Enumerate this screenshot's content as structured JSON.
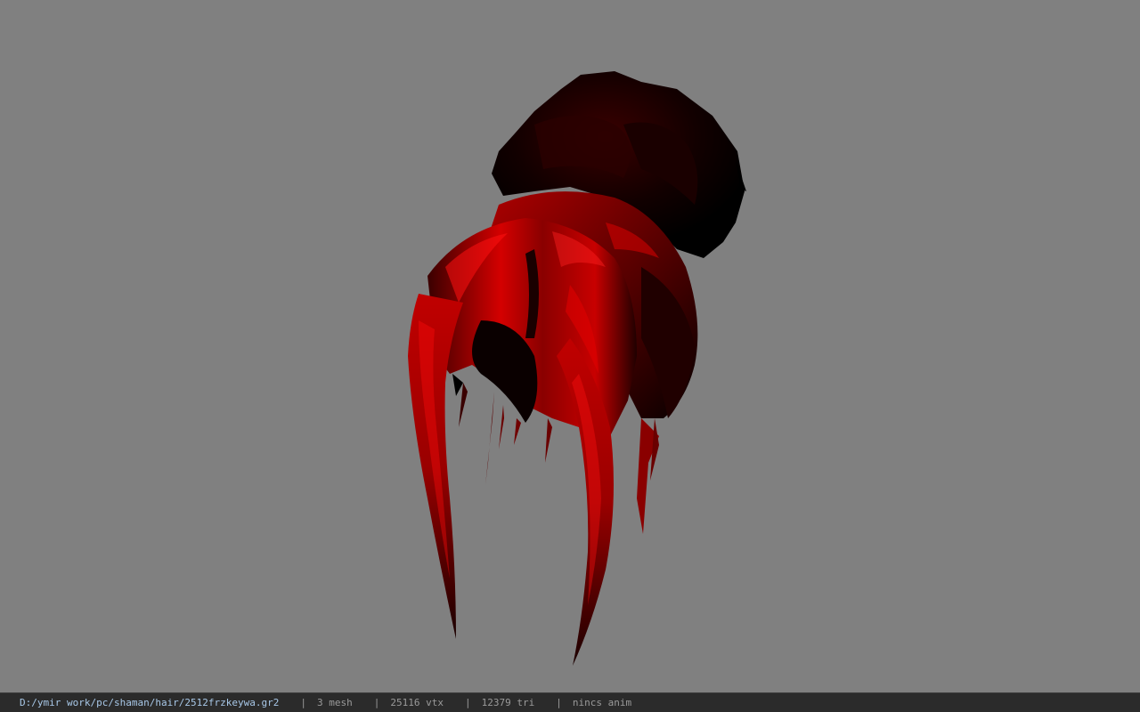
{
  "status_bar": {
    "file_path": "D:/ymir work/pc/shaman/hair/2512frzkeywa.gr2",
    "separator": "|",
    "mesh_count": "3 mesh",
    "vertex_count": "25116 vtx",
    "triangle_count": "12379 tri",
    "animation_status": "nincs anim"
  },
  "viewport": {
    "background_color": "#808080",
    "model": {
      "description_icon": "hair-model",
      "primary_color": "#cc0000",
      "shadow_color": "#000000"
    }
  }
}
